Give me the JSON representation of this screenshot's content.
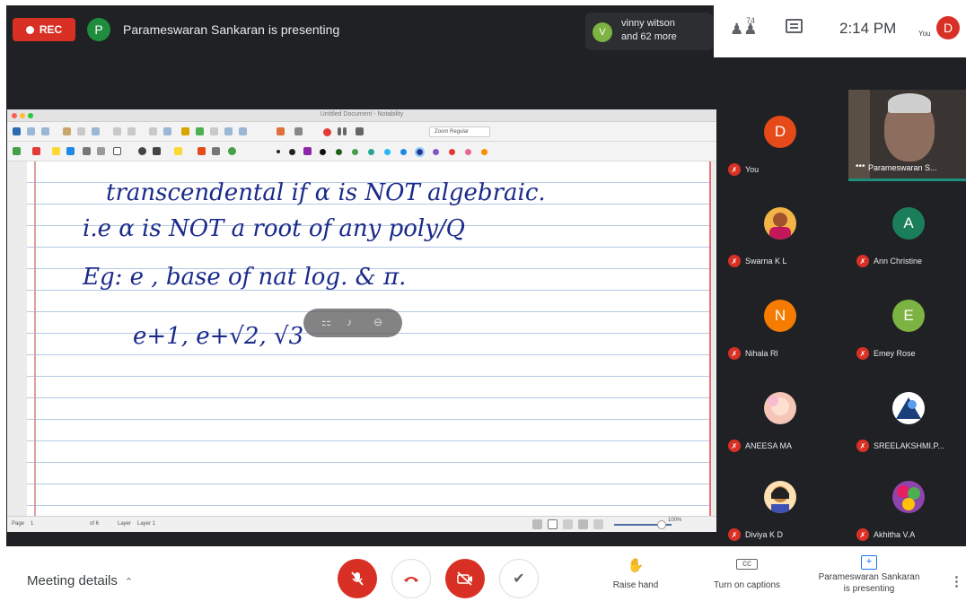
{
  "topbar": {
    "rec_label": "REC",
    "presenter_initial": "P",
    "presenting_text": "Parameswaran Sankaran is presenting",
    "viewers_initial": "V",
    "viewers_line1": "vinny witson",
    "viewers_line2": "and 62 more",
    "people_count": "74",
    "time": "2:14 PM",
    "you_label": "You",
    "self_initial": "D"
  },
  "board": {
    "window_title": "Untitled Document - Notability",
    "zoom_label": "Zoom Regular",
    "ink_lines": [
      "transcendental if α is NOT algebraic.",
      "i.e α is NOT a root of any poly/Q",
      "Eg:  e ,  base of nat log. & π.",
      "e+1,  e+√2,  √3"
    ],
    "status_page_label": "Page",
    "status_page": "1",
    "status_of": "of 6",
    "status_layer_label": "Layer",
    "status_layer": "Layer 1",
    "status_zoom": "100%"
  },
  "participants": [
    {
      "name": "You",
      "initial": "D",
      "color": "#e64a19"
    },
    {
      "name": "Swarna K L",
      "initial": "",
      "color": "#f2b447"
    },
    {
      "name": "Ann Christine",
      "initial": "A",
      "color": "#1b7e5a"
    },
    {
      "name": "Nihala Rl",
      "initial": "N",
      "color": "#f57c00"
    },
    {
      "name": "Emey Rose",
      "initial": "E",
      "color": "#7cb342"
    },
    {
      "name": "ANEESA MA",
      "initial": "",
      "color": "#f5c6b8"
    },
    {
      "name": "SREELAKSHMI.P...",
      "initial": "",
      "color": "#4a6fa5"
    },
    {
      "name": "Diviya K D",
      "initial": "",
      "color": "#ffe0b2"
    },
    {
      "name": "Akhitha V.A",
      "initial": "",
      "color": "#8e44ad"
    }
  ],
  "presenter_tile": {
    "name": "Parameswaran S...",
    "more": "•••"
  },
  "controls": {
    "meeting_details": "Meeting details",
    "raise_hand": "Raise hand",
    "captions": "Turn on captions",
    "presenting_line1": "Parameswaran Sankaran",
    "presenting_line2": "is presenting"
  },
  "colors": {
    "accent_red": "#d93025",
    "stage_bg": "#202124",
    "ink": "#1a2a8a"
  }
}
